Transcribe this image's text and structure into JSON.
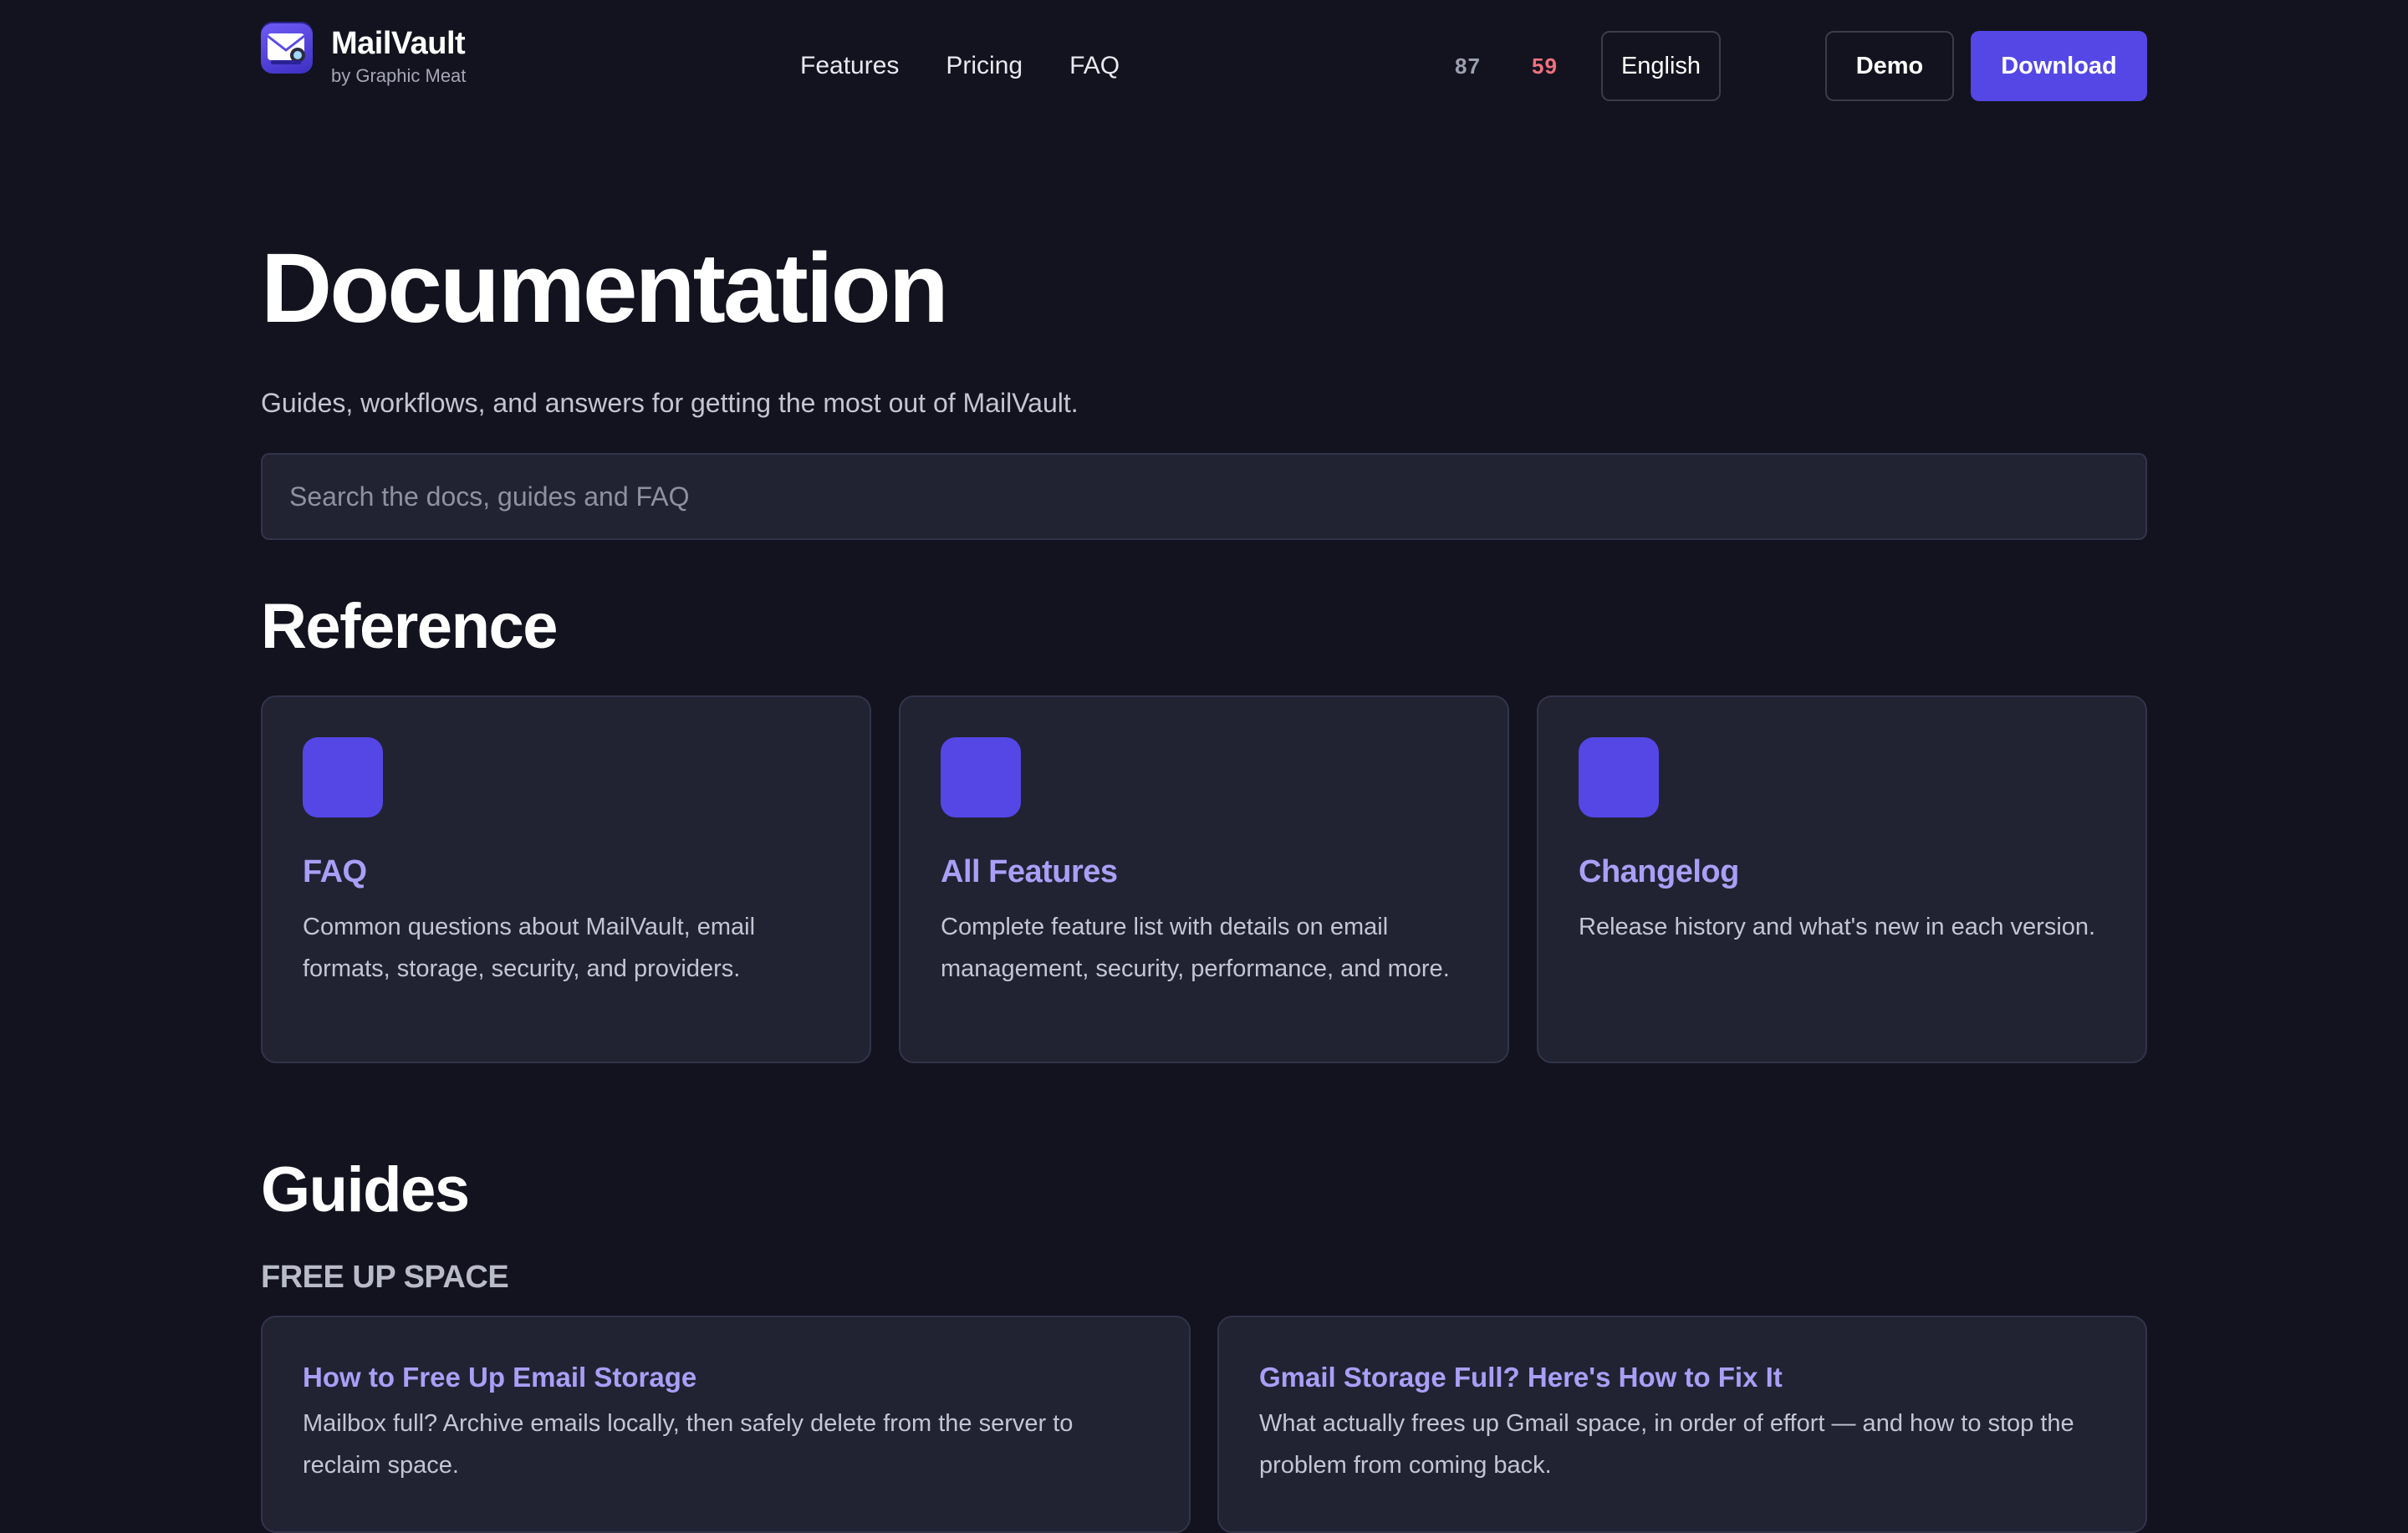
{
  "header": {
    "brand_name": "MailVault",
    "brand_sub": "by Graphic Meat",
    "logo_icon": "mail-envelope-icon",
    "nav": [
      {
        "label": "Features"
      },
      {
        "label": "Pricing"
      },
      {
        "label": "FAQ"
      }
    ],
    "stat_a": "87",
    "stat_b": "59",
    "language": "English",
    "demo_label": "Demo",
    "download_label": "Download"
  },
  "hero": {
    "title": "Documentation",
    "subtitle": "Guides, workflows, and answers for getting the most out of MailVault.",
    "search_placeholder": "Search the docs, guides and FAQ"
  },
  "reference": {
    "title": "Reference",
    "cards": [
      {
        "title": "FAQ",
        "description": "Common questions about MailVault, email formats, storage, security, and providers."
      },
      {
        "title": "All Features",
        "description": "Complete feature list with details on email management, security, performance, and more."
      },
      {
        "title": "Changelog",
        "description": "Release history and what's new in each version."
      }
    ]
  },
  "guides": {
    "title": "Guides",
    "category": "FREE UP SPACE",
    "items": [
      {
        "title": "How to Free Up Email Storage",
        "description": "Mailbox full? Archive emails locally, then safely delete from the server to reclaim space."
      },
      {
        "title": "Gmail Storage Full? Here's How to Fix It",
        "description": "What actually frees up Gmail space, in order of effort — and how to stop the problem from coming back."
      }
    ]
  },
  "colors": {
    "background": "#13131f",
    "card": "#212332",
    "accent": "#5447e6",
    "link": "#a99ff7",
    "stat_highlight": "#f0717f"
  }
}
